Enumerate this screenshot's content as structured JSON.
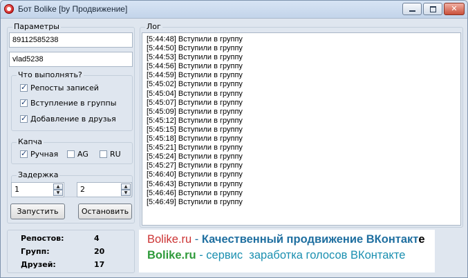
{
  "window": {
    "title": "Бот Bolike [by Продвижение]"
  },
  "params": {
    "legend": "Параметры",
    "login": "89112585238",
    "password": "vlad5238"
  },
  "actions": {
    "legend": "Что выполнять?",
    "items": [
      {
        "label": "Репосты записей",
        "checked": true
      },
      {
        "label": "Вступление в группы",
        "checked": true
      },
      {
        "label": "Добавление в друзья",
        "checked": true
      }
    ]
  },
  "captcha": {
    "legend": "Капча",
    "items": [
      {
        "label": "Ручная",
        "checked": true
      },
      {
        "label": "AG",
        "checked": false
      },
      {
        "label": "RU",
        "checked": false
      }
    ]
  },
  "delay": {
    "legend": "Задержка",
    "from": "1",
    "to": "2"
  },
  "buttons": {
    "start": "Запустить",
    "stop": "Остановить"
  },
  "log": {
    "legend": "Лог",
    "lines": [
      "[5:44:48] Вступили в группу",
      "[5:44:50] Вступили в группу",
      "[5:44:53] Вступили в группу",
      "[5:44:56] Вступили в группу",
      "[5:44:59] Вступили в группу",
      "[5:45:02] Вступили в группу",
      "[5:45:04] Вступили в группу",
      "[5:45:07] Вступили в группу",
      "[5:45:09] Вступили в группу",
      "[5:45:12] Вступили в группу",
      "[5:45:15] Вступили в группу",
      "[5:45:18] Вступили в группу",
      "[5:45:21] Вступили в группу",
      "[5:45:24] Вступили в группу",
      "[5:45:27] Вступили в группу",
      "[5:46:40] Вступили в группу",
      "[5:46:43] Вступили в группу",
      "[5:46:46] Вступили в группу",
      "[5:46:49] Вступили в группу"
    ]
  },
  "stats": [
    {
      "label": "Репостов:",
      "value": "4"
    },
    {
      "label": "Групп:",
      "value": "20"
    },
    {
      "label": "Друзей:",
      "value": "17"
    }
  ],
  "banner": {
    "line1": {
      "brand": "Bolike.ru",
      "sep": " - ",
      "text": "Качественный продвижение ВКонтакт",
      "tail": "е"
    },
    "line2": {
      "brand": "Bolike.ru",
      "sep": " - ",
      "text": "сервис  заработка голосов ВКонтакте"
    }
  },
  "colors": {
    "brand_red": "#cc3333",
    "brand_green": "#2e9a3a",
    "text_blue": "#1f6fa0",
    "text_cyan": "#1a8fb0"
  }
}
